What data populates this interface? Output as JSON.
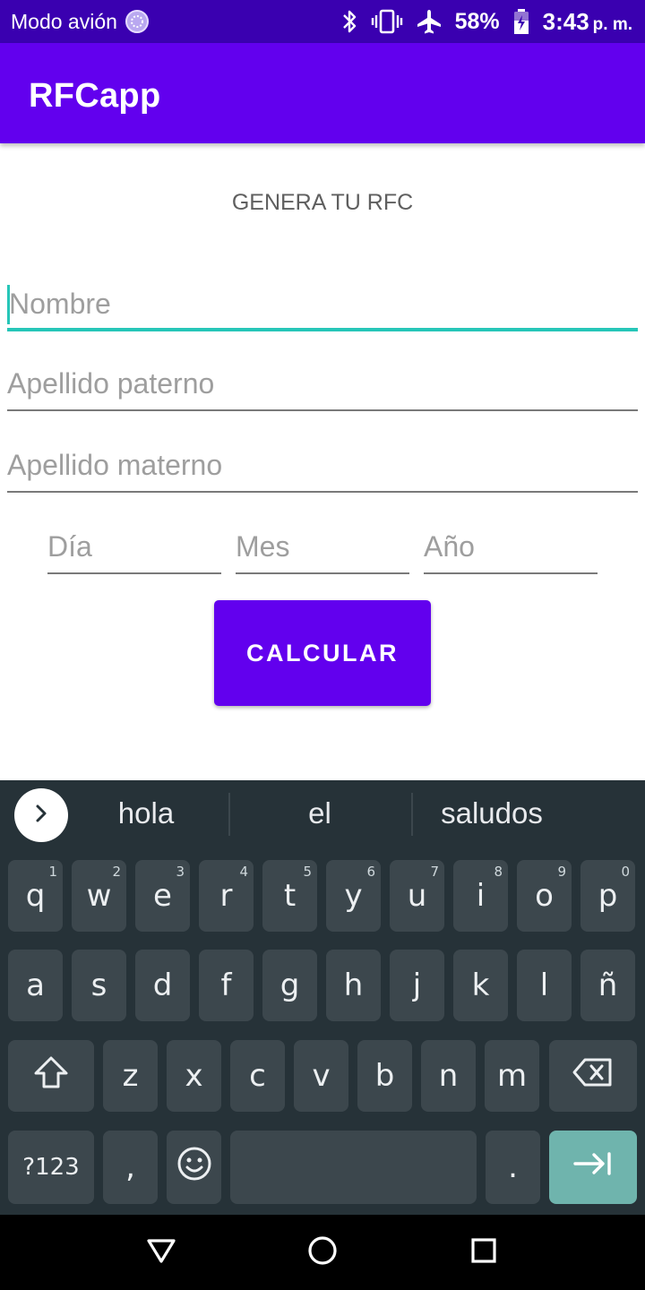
{
  "status_bar": {
    "mode_text": "Modo avión",
    "battery": "58%",
    "time": "3:43",
    "ampm": "p. m.",
    "icons": [
      "sync-icon",
      "bluetooth-icon",
      "vibrate-icon",
      "airplane-icon",
      "battery-icon"
    ]
  },
  "app_bar": {
    "title": "RFCapp",
    "color": "#6200ee"
  },
  "form": {
    "heading": "GENERA TU RFC",
    "nombre_placeholder": "Nombre",
    "apellido_paterno_placeholder": "Apellido paterno",
    "apellido_materno_placeholder": "Apellido materno",
    "dia_placeholder": "Día",
    "mes_placeholder": "Mes",
    "anio_placeholder": "Año",
    "calcular_label": "CALCULAR",
    "accent_color": "#26c6b8"
  },
  "keyboard": {
    "suggestions": [
      "hola",
      "el",
      "saludos"
    ],
    "row1": [
      "q",
      "w",
      "e",
      "r",
      "t",
      "y",
      "u",
      "i",
      "o",
      "p"
    ],
    "row1_hints": [
      "1",
      "2",
      "3",
      "4",
      "5",
      "6",
      "7",
      "8",
      "9",
      "0"
    ],
    "row2": [
      "a",
      "s",
      "d",
      "f",
      "g",
      "h",
      "j",
      "k",
      "l",
      "ñ"
    ],
    "row3": [
      "z",
      "x",
      "c",
      "v",
      "b",
      "n",
      "m"
    ],
    "symbols_label": "?123",
    "comma": ",",
    "period": ".",
    "icons": [
      "chevron-right-icon",
      "shift-icon",
      "backspace-icon",
      "emoji-icon",
      "next-tab-icon"
    ]
  },
  "nav_bar": {
    "icons": [
      "back-icon",
      "home-icon",
      "recents-icon"
    ]
  }
}
